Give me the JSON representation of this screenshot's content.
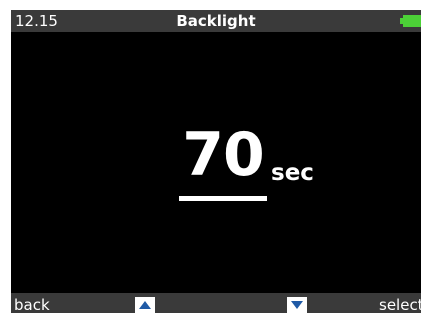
{
  "status_bar": {
    "time": "12.15",
    "title": "Backlight",
    "battery_icon": "battery-full-icon",
    "battery_color": "#4cd137"
  },
  "setting": {
    "value": "70",
    "unit": "sec"
  },
  "softkeys": {
    "left_label": "back",
    "up_icon": "arrow-up-icon",
    "down_icon": "arrow-down-icon",
    "right_label": "select"
  },
  "colors": {
    "screen_bg": "#000000",
    "bar_bg": "#3a3a3a",
    "text": "#ffffff",
    "arrow_blue": "#1f5aa6"
  }
}
